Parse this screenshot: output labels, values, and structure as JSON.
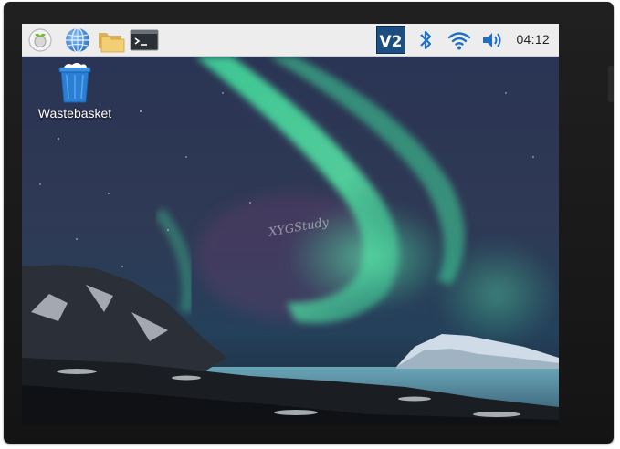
{
  "panel": {
    "menu_icon": "raspberry-menu-icon",
    "browser_icon": "web-browser-icon",
    "files_icon": "file-manager-icon",
    "terminal_icon": "terminal-icon",
    "vnc_label": "V2",
    "bluetooth_icon": "bluetooth-icon",
    "wifi_icon": "wifi-icon",
    "volume_icon": "volume-icon",
    "clock": "04:12"
  },
  "desktop": {
    "icons": [
      {
        "label": "Wastebasket",
        "icon": "wastebasket-icon"
      }
    ],
    "watermark": "XYGStudy"
  },
  "colors": {
    "panel_bg": "#ededed",
    "accent_blue": "#1f6fc5",
    "vnc_bg": "#1b4f82",
    "aurora_green": "#4fe0a0"
  }
}
